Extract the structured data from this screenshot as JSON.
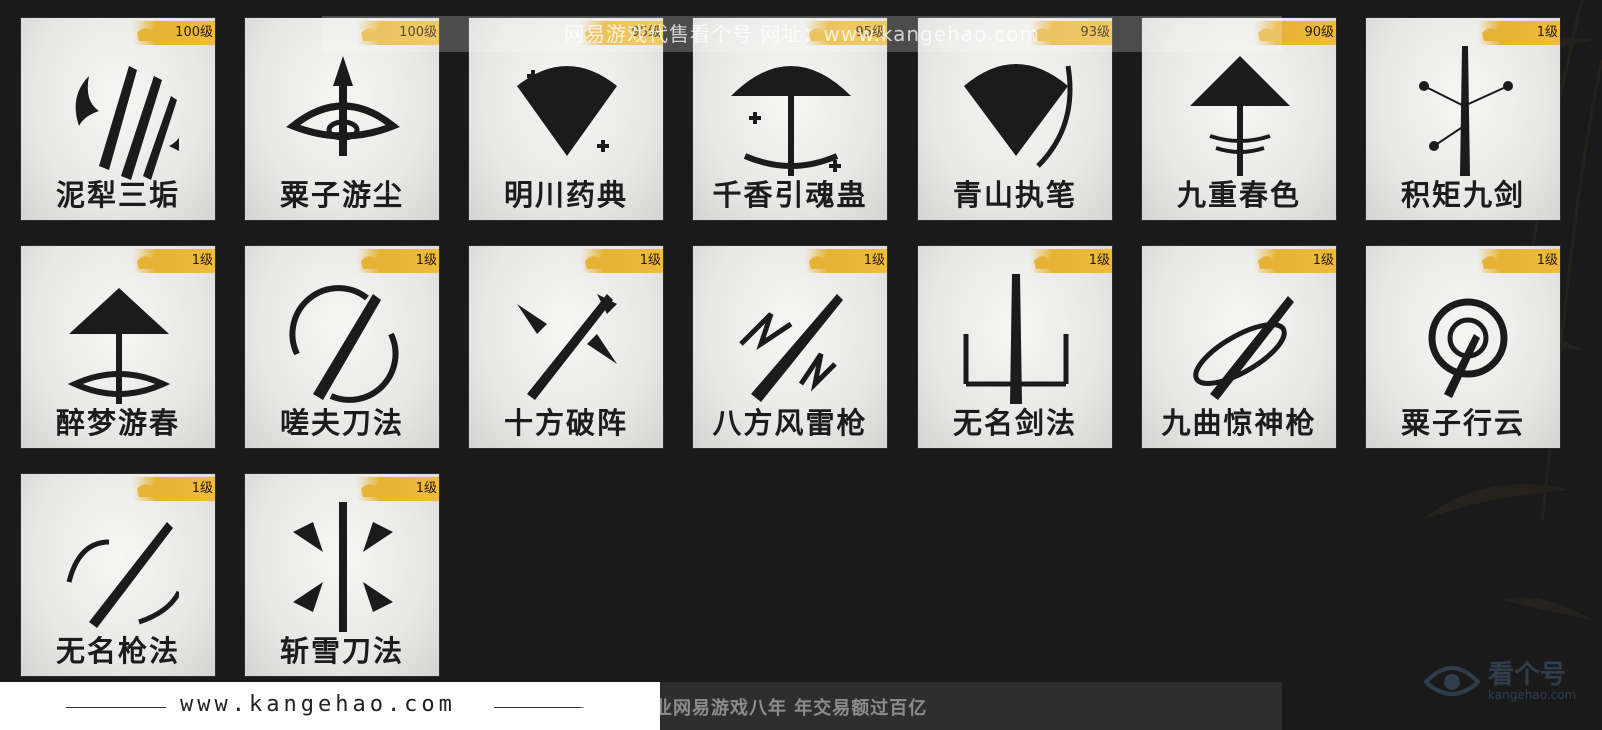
{
  "skills": [
    {
      "name": "泥犁三垢",
      "level": "100级",
      "icon": "claws-flame-icon"
    },
    {
      "name": "粟子游尘",
      "level": "100级",
      "icon": "spear-swirl-icon"
    },
    {
      "name": "明川药典",
      "level": "95级",
      "icon": "fan-heal-icon"
    },
    {
      "name": "千香引魂蛊",
      "level": "95级",
      "icon": "umbrella-heal-icon"
    },
    {
      "name": "青山执笔",
      "level": "93级",
      "icon": "fan-icon"
    },
    {
      "name": "九重春色",
      "level": "90级",
      "icon": "umbrella-icon"
    },
    {
      "name": "积矩九剑",
      "level": "1级",
      "icon": "sword-constellation-icon"
    },
    {
      "name": "醉梦游春",
      "level": "1级",
      "icon": "umbrella-swirl-icon"
    },
    {
      "name": "嗟夫刀法",
      "level": "1级",
      "icon": "blade-circle-icon"
    },
    {
      "name": "十方破阵",
      "level": "1级",
      "icon": "crossed-swords-icon"
    },
    {
      "name": "八方风雷枪",
      "level": "1级",
      "icon": "spear-thunder-icon"
    },
    {
      "name": "无名剑法",
      "level": "1级",
      "icon": "sword-ward-icon"
    },
    {
      "name": "九曲惊神枪",
      "level": "1级",
      "icon": "spear-orbit-icon"
    },
    {
      "name": "粟子行云",
      "level": "1级",
      "icon": "spear-spiral-icon"
    },
    {
      "name": "无名枪法",
      "level": "1级",
      "icon": "spear-arc-icon"
    },
    {
      "name": "斩雪刀法",
      "level": "1级",
      "icon": "blade-arrows-icon"
    }
  ],
  "watermark": {
    "top": "网易游戏代售看个号   网址：www.kangehao.com",
    "url": "www.kangehao.com",
    "slogan": "看个号专业网易游戏八年   年交易额过百亿",
    "brand": "看个号",
    "brand_sub": "kangehao.com"
  },
  "colors": {
    "badge": "#e7b336",
    "background": "#1a1a1a",
    "card": "#ececea"
  }
}
